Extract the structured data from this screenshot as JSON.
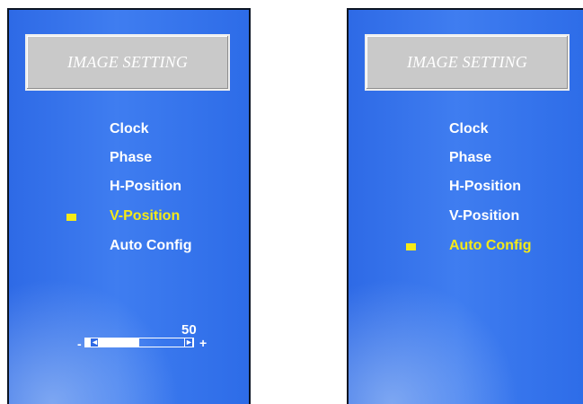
{
  "colors": {
    "panel_blue": "#3a76ee",
    "highlight_yellow": "#f5ea17",
    "title_box_gray": "#c9c9c9",
    "text_white": "#ffffff"
  },
  "left_panel": {
    "title": "IMAGE SETTING",
    "menu": [
      "Clock",
      "Phase",
      "H-Position",
      "V-Position",
      "Auto Config"
    ],
    "selected": "V-Position",
    "slider": {
      "value": "50",
      "minus": "-",
      "plus": "+",
      "left_arrow": "◄",
      "right_arrow": "►",
      "fraction": 0.5
    }
  },
  "right_panel": {
    "title": "IMAGE SETTING",
    "menu": [
      "Clock",
      "Phase",
      "H-Position",
      "V-Position",
      "Auto Config"
    ],
    "selected": "Auto Config"
  }
}
